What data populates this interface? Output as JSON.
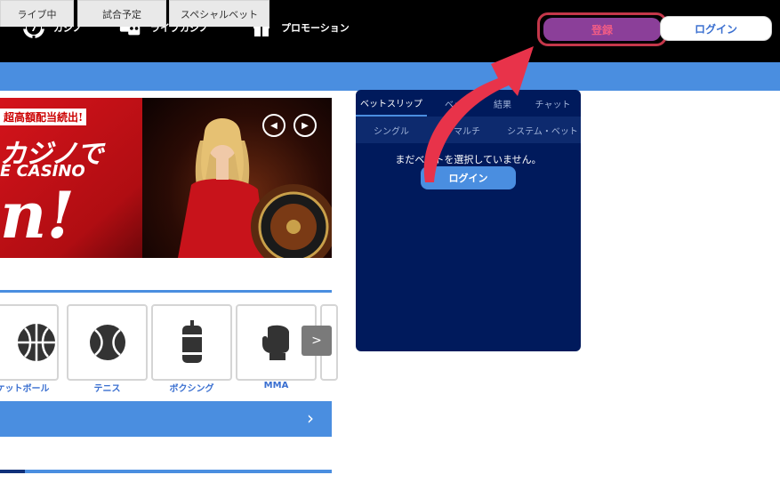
{
  "header": {
    "nav": [
      {
        "label": "カジノ",
        "icon": "casino-chip-icon"
      },
      {
        "label": "ライブカジノ",
        "icon": "live-cards-icon"
      },
      {
        "label": "プロモーション",
        "icon": "gift-icon"
      }
    ],
    "register_label": "登録",
    "login_label": "ログイン"
  },
  "banner": {
    "tag": "超高額配当続出!",
    "line1": "カジノで",
    "line2": "E CASINO",
    "line3": "n!"
  },
  "sports_tabs": [
    "ライブ中",
    "試合予定",
    "スペシャルベット"
  ],
  "sports": [
    {
      "label": "スケットボール",
      "icon": "basketball-icon"
    },
    {
      "label": "テニス",
      "icon": "tennis-ball-icon"
    },
    {
      "label": "ボクシング",
      "icon": "punching-bag-icon"
    },
    {
      "label": "MMA",
      "icon": "boxing-glove-icon"
    }
  ],
  "scroll_next": ">",
  "betslip": {
    "tabs": [
      "ベットスリップ",
      "ベッ",
      "結果",
      "チャット"
    ],
    "subtabs": [
      "シングル",
      "マルチ",
      "システム・ベット"
    ],
    "message": "まだベットを選択していません。",
    "login_label": "ログイン"
  },
  "colors": {
    "accent_blue": "#4a8ee0",
    "panel_navy": "#001a5c",
    "register_purple": "#8b3f99",
    "pointer_red": "#e8334a"
  }
}
